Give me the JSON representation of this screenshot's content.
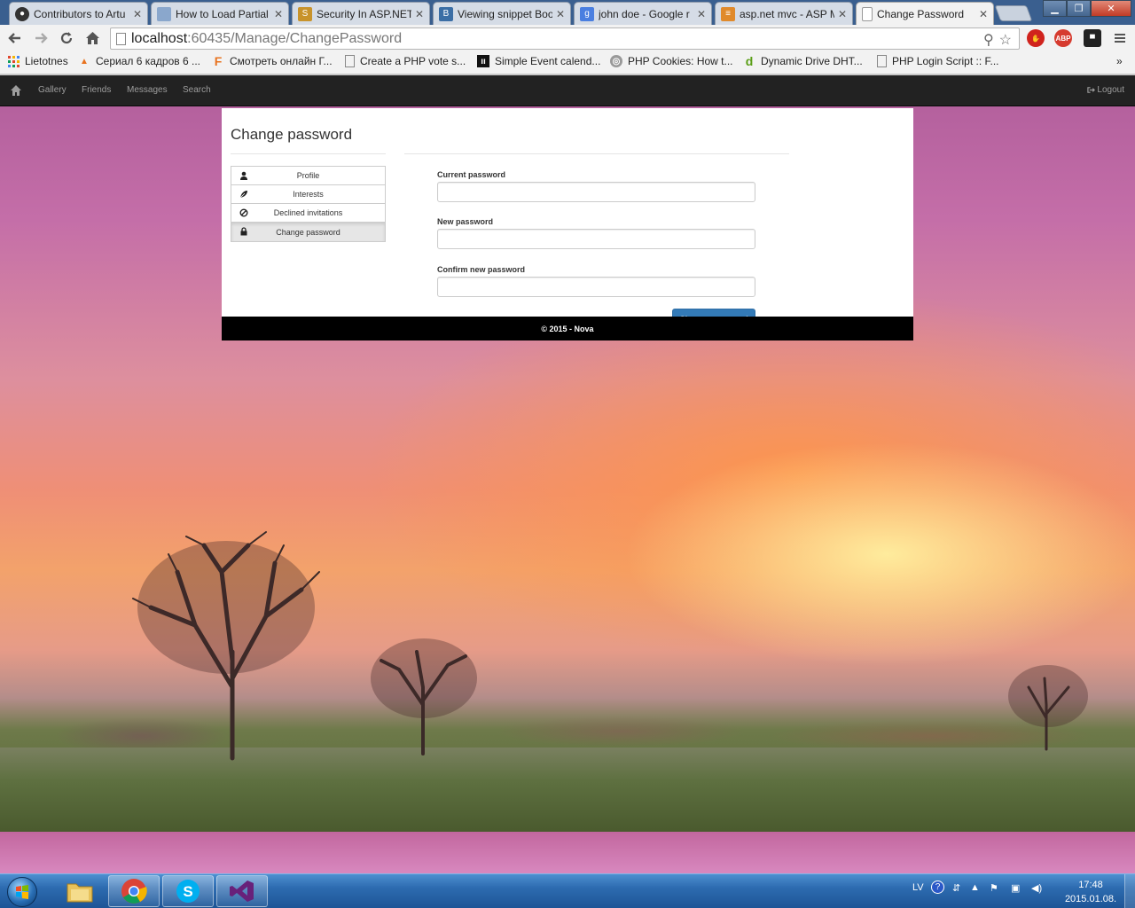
{
  "browser": {
    "tabs": [
      {
        "title": "Contributors to Artu",
        "favicon": "github-icon",
        "color": "#333333"
      },
      {
        "title": "How to Load Partial",
        "favicon": "doc-icon",
        "color": "#8aa7cc"
      },
      {
        "title": "Security In ASP.NET",
        "favicon": "shield-icon",
        "color": "#c8932b"
      },
      {
        "title": "Viewing snippet Boo",
        "favicon": "bootsnipp-icon",
        "color": "#3b6ea5"
      },
      {
        "title": "john doe - Google r",
        "favicon": "google-icon",
        "color": "#4a7fe0"
      },
      {
        "title": "asp.net mvc - ASP M",
        "favicon": "stackoverflow-icon",
        "color": "#e08a2b"
      },
      {
        "title": "Change Password",
        "favicon": "page-icon",
        "color": "#ffffff"
      }
    ],
    "url_host": "localhost",
    "url_rest": ":60435/Manage/ChangePassword",
    "bookmarks": [
      {
        "label": "Lietotnes",
        "icon": "apps-grid-icon"
      },
      {
        "label": "Сериал 6 кадров 6 ...",
        "icon": "fox-icon"
      },
      {
        "label": "Смотреть онлайн Г...",
        "icon": "f-logo-icon"
      },
      {
        "label": "Create a PHP vote s...",
        "icon": "page-icon"
      },
      {
        "label": "Simple Event calend...",
        "icon": "plugin-icon"
      },
      {
        "label": "PHP Cookies: How t...",
        "icon": "globe-icon"
      },
      {
        "label": "Dynamic Drive DHT...",
        "icon": "d-logo-icon"
      },
      {
        "label": "PHP Login Script :: F...",
        "icon": "page-icon"
      }
    ],
    "bookmarks_overflow": "»",
    "abp_label": "ABP"
  },
  "site": {
    "nav": [
      "Gallery",
      "Friends",
      "Messages",
      "Search"
    ],
    "logout": "Logout",
    "page_title": "Change password",
    "menu": [
      {
        "label": "Profile",
        "icon": "user-icon",
        "active": false
      },
      {
        "label": "Interests",
        "icon": "leaf-icon",
        "active": false
      },
      {
        "label": "Declined invitations",
        "icon": "ban-icon",
        "active": false
      },
      {
        "label": "Change password",
        "icon": "lock-icon",
        "active": true
      }
    ],
    "form": {
      "current_label": "Current password",
      "current_value": "",
      "new_label": "New password",
      "new_value": "",
      "confirm_label": "Confirm new password",
      "confirm_value": "",
      "submit_label": "Change password"
    },
    "footer": "© 2015 - Nova",
    "accent": "#337ab7"
  },
  "taskbar": {
    "language": "LV",
    "time": "17:48",
    "date": "2015.01.08.",
    "apps": [
      "explorer-icon",
      "chrome-icon",
      "skype-icon",
      "visual-studio-icon"
    ]
  }
}
